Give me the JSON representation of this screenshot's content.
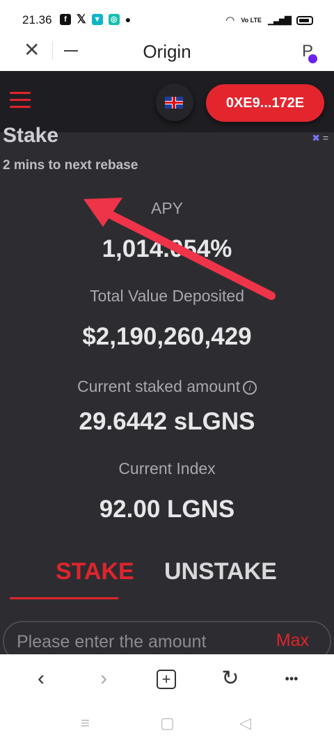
{
  "status_bar": {
    "time": "21.36",
    "left_icons": [
      "facebook-icon",
      "x-icon",
      "shop-icon",
      "chat-icon",
      "dot-icon"
    ],
    "right_icons": [
      "wifi-icon",
      "volte-icon",
      "signal-icon",
      "battery-icon"
    ],
    "volte_text": "Vo LTE"
  },
  "browser": {
    "title": "Origin",
    "avatar_letter": "P"
  },
  "app": {
    "wallet_address": "0XE9...172E",
    "language_flag": "uk-flag-icon",
    "page_title": "Stake",
    "rebase_text": "2 mins to next rebase",
    "stats": {
      "apy_label": "APY",
      "apy_value": "1,014.054%",
      "tvd_label": "Total Value Deposited",
      "tvd_value": "$2,190,260,429",
      "staked_label": "Current staked amount",
      "staked_value": "29.6442 sLGNS",
      "index_label": "Current Index",
      "index_value": "92.00 LGNS"
    },
    "tabs": {
      "stake": "STAKE",
      "unstake": "UNSTAKE"
    },
    "amount": {
      "placeholder": "Please enter the amount",
      "max_label": "Max"
    }
  },
  "toolbar": {
    "back": "‹",
    "forward": "›",
    "new_tab": "+",
    "refresh": "↻",
    "more": "•••"
  },
  "nav_bar": {
    "menu": "≡",
    "home": "▢",
    "back": "◁"
  },
  "colors": {
    "accent_red": "#e0242c",
    "app_background": "#2d2d31",
    "topbar_background": "#1e1e22"
  }
}
